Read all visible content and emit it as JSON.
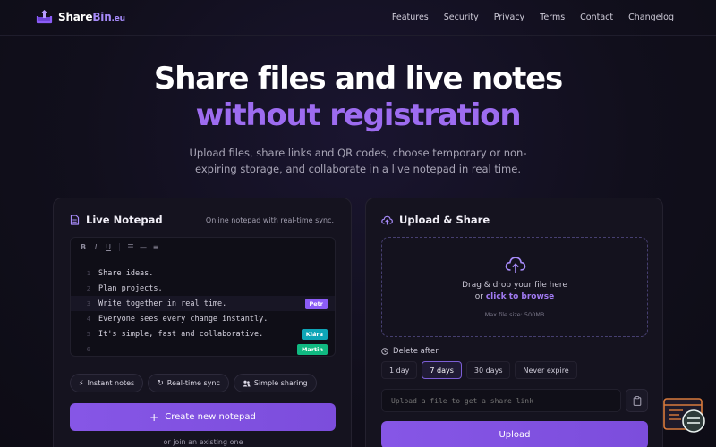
{
  "nav": {
    "brand_main": "Share",
    "brand_accent": "Bin",
    "brand_suffix": ".eu",
    "links": [
      "Features",
      "Security",
      "Privacy",
      "Terms",
      "Contact",
      "Changelog"
    ]
  },
  "hero": {
    "title_line1": "Share files and live notes",
    "title_line2": "without registration",
    "subtitle": "Upload files, share links and QR codes, choose temporary or non-expiring storage, and collaborate in a live notepad in real time."
  },
  "notepad": {
    "title": "Live Notepad",
    "hint": "Online notepad with real-time sync.",
    "lines": [
      {
        "num": "1",
        "text": "Share ideas.",
        "user": "",
        "color": ""
      },
      {
        "num": "2",
        "text": "Plan projects.",
        "user": "",
        "color": ""
      },
      {
        "num": "3",
        "text": "Write together in real time.",
        "user": "Petr",
        "color": "#8b5cf6"
      },
      {
        "num": "4",
        "text": "Everyone sees every change instantly.",
        "user": "",
        "color": ""
      },
      {
        "num": "5",
        "text": "It's simple, fast and collaborative.",
        "user": "Klára",
        "color": "#0ea5b7"
      },
      {
        "num": "6",
        "text": "",
        "user": "Martin",
        "color": "#10b981"
      }
    ],
    "chips": [
      "Instant notes",
      "Real-time sync",
      "Simple sharing"
    ],
    "create_label": "Create new notepad",
    "join_text": "or join an existing one"
  },
  "upload": {
    "title": "Upload & Share",
    "drop_text": "Drag & drop your file here",
    "or_text": "or ",
    "browse_text": "click to browse",
    "max_size": "Max file size: 500MB",
    "delete_label": "Delete after",
    "durations": [
      "1 day",
      "7 days",
      "30 days",
      "Never expire"
    ],
    "selected_duration": "7 days",
    "link_placeholder": "Upload a file to get a share link",
    "upload_label": "Upload"
  },
  "colors": {
    "accent": "#8b5cf6",
    "accent_text": "#9d6cf0"
  }
}
